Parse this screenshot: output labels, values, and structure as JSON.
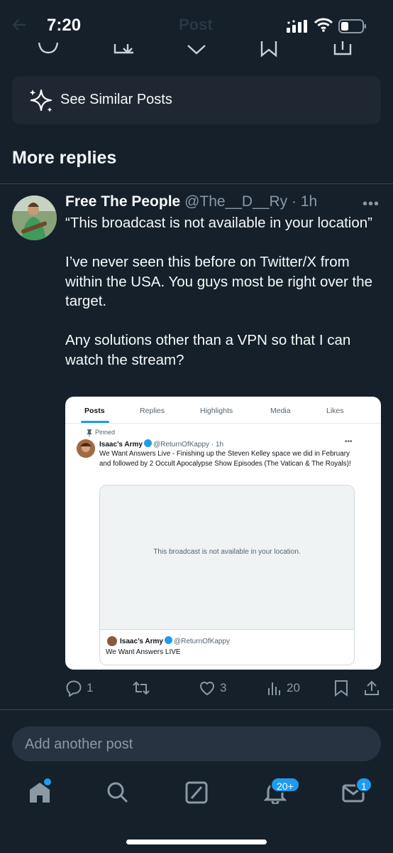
{
  "status_bar": {
    "time": "7:20"
  },
  "header": {
    "title": "Post"
  },
  "similar": {
    "label": "See Similar Posts"
  },
  "section": {
    "title": "More replies"
  },
  "reply": {
    "name": "Free The People",
    "handle": "@The__D__Ry",
    "time": "1h",
    "paragraphs": [
      "“This broadcast is not available in your location”",
      "I’ve never seen this before on Twitter/X from within the USA.  You guys most be right over the target.",
      "Any solutions other than a VPN so that I can watch the stream?"
    ],
    "actions": {
      "replies": "1",
      "reposts": "",
      "likes": "3",
      "views": "20"
    }
  },
  "embed": {
    "tabs": [
      "Posts",
      "Replies",
      "Highlights",
      "Media",
      "Likes"
    ],
    "pinned_label": "Pinned",
    "author_name": "Isaac’s Army",
    "author_handle": "@ReturnOfKappy",
    "time": "1h",
    "text": "We Want Answers Live - Finishing up the Steven Kelley space we did in February and followed by 2 Occult Apocalypse Show Episodes (The Vatican & The Royals)!",
    "unavailable": "This broadcast is not available in your location.",
    "card_author": "Isaac’s Army",
    "card_handle": "@ReturnOfKappy",
    "card_title": "We Want Answers LIVE"
  },
  "compose": {
    "placeholder": "Add another post"
  },
  "tabbar": {
    "notifications_badge": "20+",
    "messages_badge": "1"
  },
  "colors": {
    "background": "#15202b",
    "accent": "#1d9bf0",
    "muted": "#8b98a5"
  }
}
